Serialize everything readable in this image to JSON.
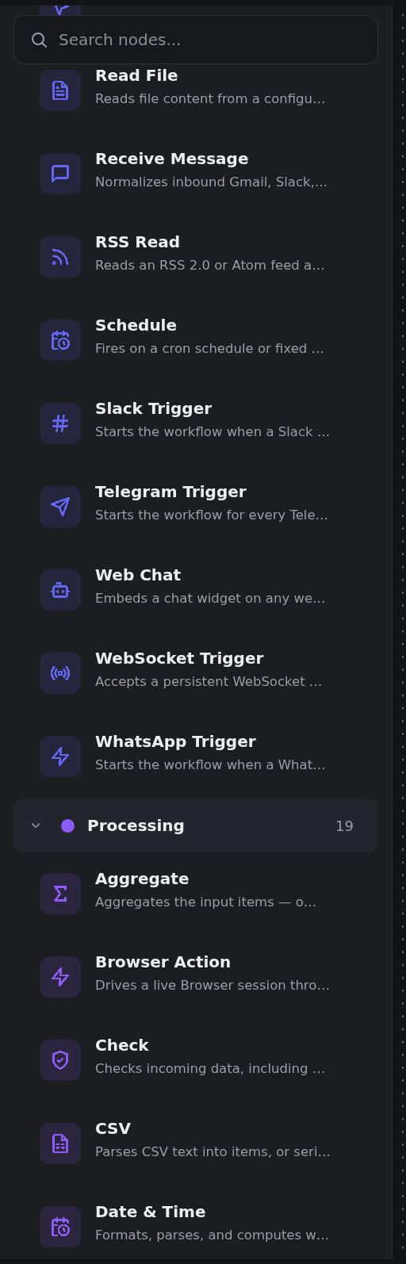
{
  "search": {
    "placeholder": "Search nodes..."
  },
  "sections": [
    {
      "kind": "continued",
      "color": "#6366f1",
      "items": [
        {
          "kind": "cursor"
        },
        {
          "kind": "file",
          "title": "Read File",
          "description": "Reads file content from a configu…"
        },
        {
          "kind": "chat",
          "title": "Receive Message",
          "description": "Normalizes inbound Gmail, Slack,…"
        },
        {
          "kind": "rss",
          "title": "RSS Read",
          "description": "Reads an RSS 2.0 or Atom feed a…"
        },
        {
          "kind": "calendar-clock",
          "title": "Schedule",
          "description": "Fires on a cron schedule or fixed …"
        },
        {
          "kind": "hash",
          "title": "Slack Trigger",
          "description": "Starts the workflow when a Slack …"
        },
        {
          "kind": "send",
          "title": "Telegram Trigger",
          "description": "Starts the workflow for every Tele…"
        },
        {
          "kind": "bot",
          "title": "Web Chat",
          "description": "Embeds a chat widget on any we…"
        },
        {
          "kind": "radio",
          "title": "WebSocket Trigger",
          "description": "Accepts a persistent WebSocket …"
        },
        {
          "kind": "zap",
          "title": "WhatsApp Trigger",
          "description": "Starts the workflow when a What…"
        }
      ]
    },
    {
      "kind": "header",
      "title": "Processing",
      "count": "19",
      "expanded": true,
      "color": "#8b5cf6",
      "items": [
        {
          "kind": "sigma",
          "title": "Aggregate",
          "description": "Aggregates the input items — o…"
        },
        {
          "kind": "zap",
          "title": "Browser Action",
          "description": "Drives a live Browser session thro…"
        },
        {
          "kind": "shield",
          "title": "Check",
          "description": "Checks incoming data, including …"
        },
        {
          "kind": "sheet",
          "title": "CSV",
          "description": "Parses CSV text into items, or seri…"
        },
        {
          "kind": "calendar-clock",
          "title": "Date & Time",
          "description": "Formats, parses, and computes w…"
        }
      ]
    }
  ]
}
